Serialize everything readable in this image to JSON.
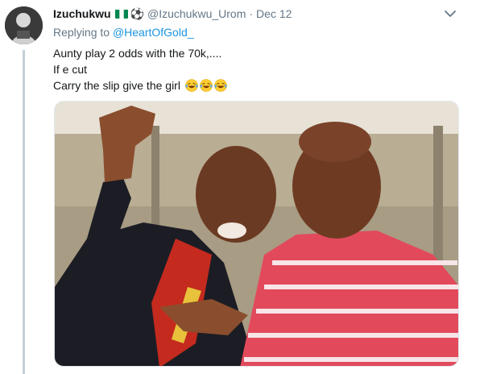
{
  "author": {
    "display_name": "Izuchukwu",
    "flag_icon": "nigeria-flag-icon",
    "ball_emoji": "⚽",
    "handle": "@Izuchukwu_Urom",
    "separator": "·",
    "time": "Dec 12"
  },
  "reply": {
    "prefix": "Replying to",
    "handle": "@HeartOfGold_"
  },
  "tweet": {
    "lines": [
      "Aunty play 2 odds with the 70k,....",
      "If e cut",
      "Carry the slip give the girl"
    ],
    "emojis": [
      "laughing-tears-icon",
      "laughing-tears-icon",
      "laughing-tears-icon"
    ]
  },
  "colors": {
    "link": "#1b95e0",
    "muted": "#657786",
    "thread_line": "#c4cfd6",
    "flag_green": "#008751"
  }
}
